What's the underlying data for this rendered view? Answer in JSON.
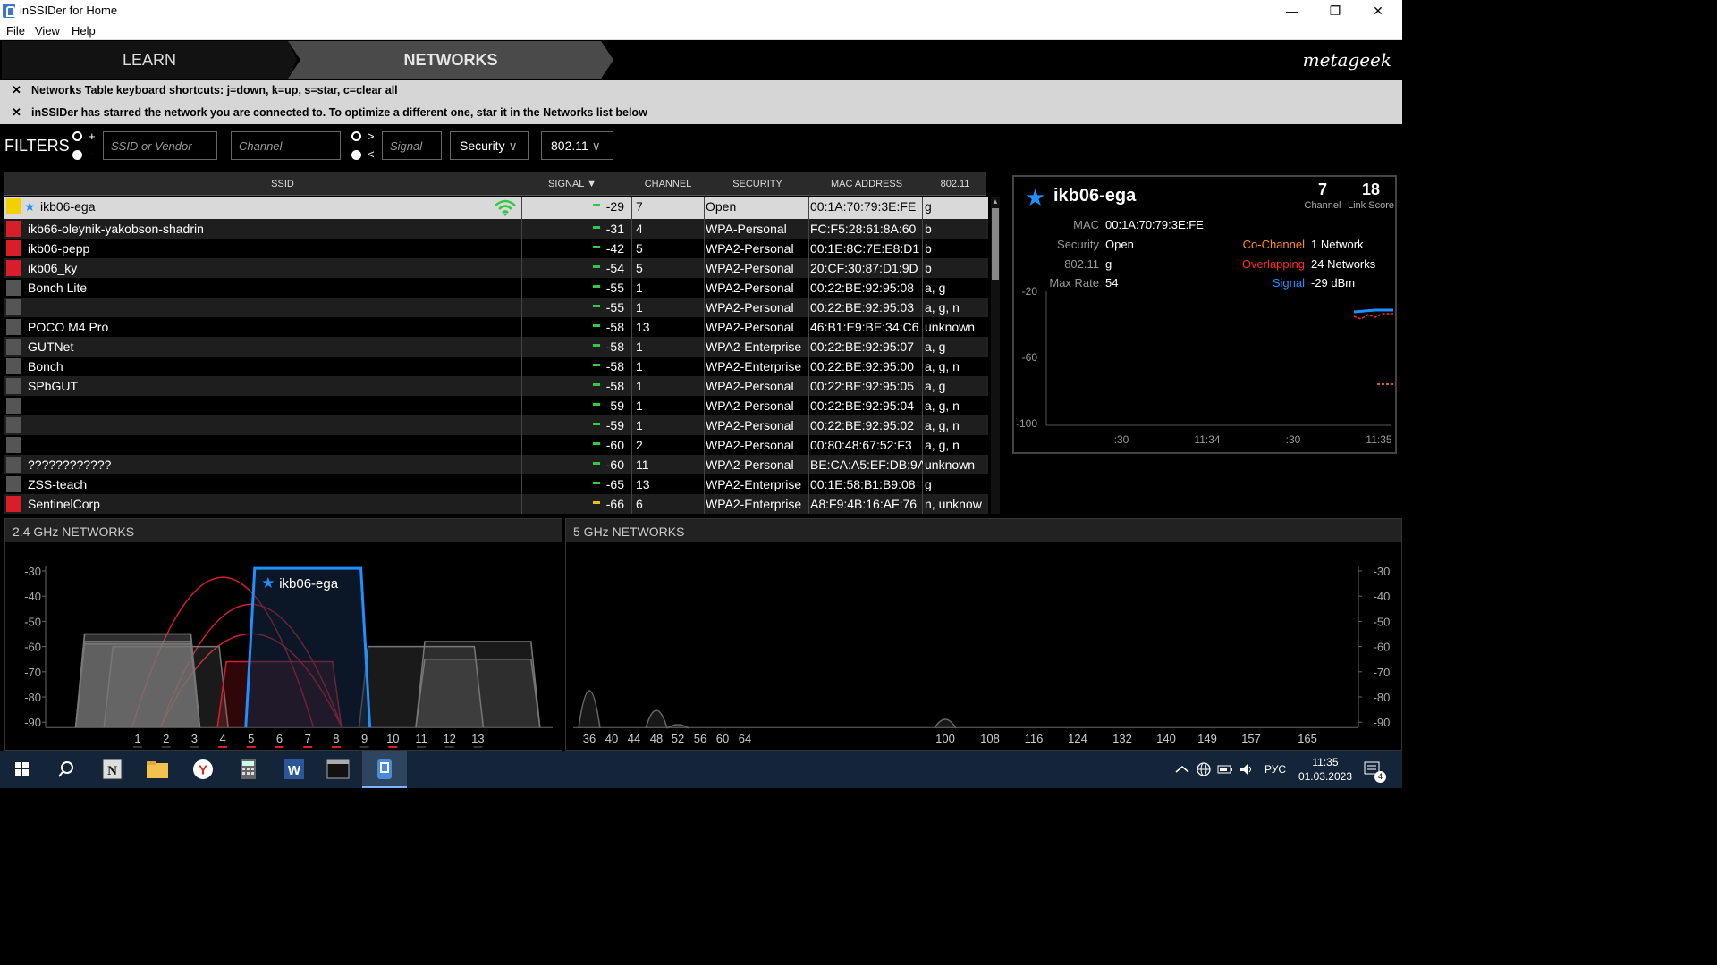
{
  "window": {
    "title": "inSSIDer for Home",
    "minimize": "—",
    "maximize": "❐",
    "close": "✕"
  },
  "menu": {
    "file": "File",
    "view": "View",
    "help": "Help"
  },
  "nav": {
    "learn": "LEARN",
    "networks": "NETWORKS",
    "logo": "metageek"
  },
  "notices": [
    "Networks Table keyboard shortcuts: j=down, k=up, s=star, c=clear all",
    "inSSIDer has starred the network you are connected to. To optimize a different one, star it in the Networks list below"
  ],
  "filters": {
    "label": "FILTERS",
    "plus": "+",
    "minus": "-",
    "gt": ">",
    "lt": "<",
    "ssid_placeholder": "SSID or Vendor",
    "channel_placeholder": "Channel",
    "signal_placeholder": "Signal",
    "security": "Security",
    "standard": "802.11",
    "chevron": "∨"
  },
  "table": {
    "headers": {
      "ssid": "SSID",
      "signal": "SIGNAL",
      "channel": "CHANNEL",
      "security": "SECURITY",
      "mac": "MAC ADDRESS",
      "std": "802.11"
    },
    "rows": [
      {
        "color": "#f5d000",
        "ssid": "ikb06-ega",
        "signal": "-29",
        "channel": "7",
        "security": "Open",
        "mac": "00:1A:70:79:3E:FE",
        "std": "g"
      },
      {
        "color": "#d81e2a",
        "ssid": "ikb66-oleynik-yakobson-shadrin",
        "signal": "-31",
        "channel": "4",
        "security": "WPA-Personal",
        "mac": "FC:F5:28:61:8A:60",
        "std": "b"
      },
      {
        "color": "#d81e2a",
        "ssid": "ikb06-pepp",
        "signal": "-42",
        "channel": "5",
        "security": "WPA2-Personal",
        "mac": "00:1E:8C:7E:E8:D1",
        "std": "b"
      },
      {
        "color": "#d81e2a",
        "ssid": "ikb06_ky",
        "signal": "-54",
        "channel": "5",
        "security": "WPA2-Personal",
        "mac": "20:CF:30:87:D1:9D",
        "std": "b"
      },
      {
        "color": "#555555",
        "ssid": "Bonch Lite",
        "signal": "-55",
        "channel": "1",
        "security": "WPA2-Personal",
        "mac": "00:22:BE:92:95:08",
        "std": "a, g"
      },
      {
        "color": "#555555",
        "ssid": "",
        "signal": "-55",
        "channel": "1",
        "security": "WPA2-Personal",
        "mac": "00:22:BE:92:95:03",
        "std": "a, g, n"
      },
      {
        "color": "#555555",
        "ssid": "POCO M4 Pro",
        "signal": "-58",
        "channel": "13",
        "security": "WPA2-Personal",
        "mac": "46:B1:E9:BE:34:C6",
        "std": "unknown"
      },
      {
        "color": "#555555",
        "ssid": "GUTNet",
        "signal": "-58",
        "channel": "1",
        "security": "WPA2-Enterprise",
        "mac": "00:22:BE:92:95:07",
        "std": "a, g"
      },
      {
        "color": "#555555",
        "ssid": "Bonch",
        "signal": "-58",
        "channel": "1",
        "security": "WPA2-Enterprise",
        "mac": "00:22:BE:92:95:00",
        "std": "a, g, n"
      },
      {
        "color": "#555555",
        "ssid": "SPbGUT",
        "signal": "-58",
        "channel": "1",
        "security": "WPA2-Personal",
        "mac": "00:22:BE:92:95:05",
        "std": "a, g"
      },
      {
        "color": "#555555",
        "ssid": "",
        "signal": "-59",
        "channel": "1",
        "security": "WPA2-Personal",
        "mac": "00:22:BE:92:95:04",
        "std": "a, g, n"
      },
      {
        "color": "#555555",
        "ssid": "",
        "signal": "-59",
        "channel": "1",
        "security": "WPA2-Personal",
        "mac": "00:22:BE:92:95:02",
        "std": "a, g, n"
      },
      {
        "color": "#555555",
        "ssid": "",
        "signal": "-60",
        "channel": "2",
        "security": "WPA2-Personal",
        "mac": "00:80:48:67:52:F3",
        "std": "a, g, n"
      },
      {
        "color": "#555555",
        "ssid": "????????????",
        "signal": "-60",
        "channel": "11",
        "security": "WPA2-Personal",
        "mac": "BE:CA:A5:EF:DB:9A",
        "std": "unknown"
      },
      {
        "color": "#555555",
        "ssid": "ZSS-teach",
        "signal": "-65",
        "channel": "13",
        "security": "WPA2-Enterprise",
        "mac": "00:1E:58:B1:B9:08",
        "std": "g"
      },
      {
        "color": "#d81e2a",
        "ssid": "SentinelCorp",
        "signal": "-66",
        "channel": "6",
        "security": "WPA2-Enterprise",
        "mac": "A8:F9:4B:16:AF:76",
        "std": "n, unknow"
      }
    ]
  },
  "detail": {
    "ssid": "ikb06-ega",
    "channel": "7",
    "channel_label": "Channel",
    "link_score": "18",
    "link_score_label": "Link Score",
    "mac_label": "MAC",
    "mac": "00:1A:70:79:3E:FE",
    "security_label": "Security",
    "security": "Open",
    "std_label": "802.11",
    "std": "g",
    "maxrate_label": "Max Rate",
    "maxrate": "54",
    "cochannel_label": "Co-Channel",
    "cochannel": "1 Network",
    "overlapping_label": "Overlapping",
    "overlapping": "24 Networks",
    "signal_label": "Signal",
    "signal": "-29 dBm",
    "graph_y": [
      "-20",
      "-60",
      "-100"
    ],
    "graph_x": [
      ":30",
      "11:34",
      ":30",
      "11:35"
    ],
    "cochannel_color": "#ff8c1a",
    "overlapping_color": "#ff2a2a",
    "signal_color": "#1e90ff"
  },
  "g24": {
    "title": "2.4 GHz NETWORKS",
    "y_ticks": [
      "-30",
      "-40",
      "-50",
      "-60",
      "-70",
      "-80",
      "-90"
    ],
    "channels": [
      "1",
      "2",
      "3",
      "4",
      "5",
      "6",
      "7",
      "8",
      "9",
      "10",
      "11",
      "12",
      "13"
    ],
    "selected_label": "ikb06-ega"
  },
  "g5": {
    "title": "5 GHz NETWORKS",
    "y_ticks": [
      "-30",
      "-40",
      "-50",
      "-60",
      "-70",
      "-80",
      "-90"
    ],
    "channels": [
      "36",
      "40",
      "44",
      "48",
      "52",
      "56",
      "60",
      "64",
      "100",
      "108",
      "116",
      "124",
      "132",
      "140",
      "149",
      "157",
      "165"
    ]
  },
  "taskbar": {
    "time": "11:35",
    "date": "01.03.2023",
    "lang": "РУС",
    "notif_count": "4"
  }
}
